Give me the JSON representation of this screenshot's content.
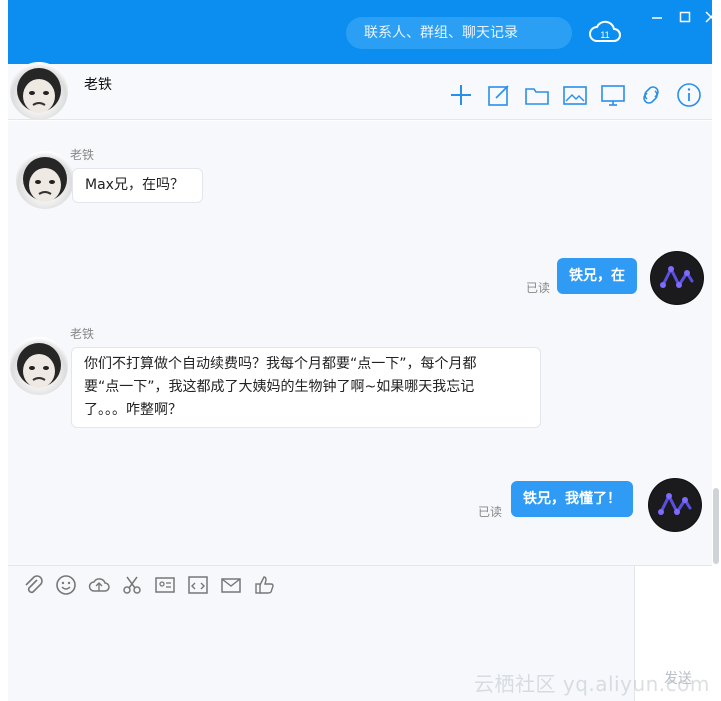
{
  "topbar": {
    "search_placeholder": "联系人、群组、聊天记录",
    "colors": {
      "bar": "#0c8ef0",
      "search": "#2a9ff3"
    }
  },
  "header": {
    "contact_name": "老铁",
    "tools": [
      "add-icon",
      "edit-note-icon",
      "folder-icon",
      "image-icon",
      "screen-share-icon",
      "link-icon",
      "info-icon"
    ]
  },
  "messages": [
    {
      "direction": "in",
      "sender": "老铁",
      "lines": [
        "Max兄，在吗？"
      ]
    },
    {
      "direction": "out",
      "text": "铁兄，在",
      "status": "已读"
    },
    {
      "direction": "in",
      "sender": "老铁",
      "lines": [
        "你们不打算做个自动续费吗？我每个月都要“点一下”，每个月都",
        "要“点一下”，我这都成了大姨妈的生物钟了啊~如果哪天我忘记",
        "了。。。咋整啊？"
      ]
    },
    {
      "direction": "out",
      "text": "铁兄，我懂了！",
      "status": "已读"
    }
  ],
  "composer": {
    "tools": [
      "attachment-icon",
      "emoji-icon",
      "cloud-upload-icon",
      "scissors-icon",
      "contact-card-icon",
      "code-icon",
      "mail-icon",
      "thumbs-up-icon"
    ],
    "send_label": "发送"
  },
  "watermark": "云栖社区 yq.aliyun.com",
  "colors": {
    "accent": "#2f9bf5",
    "chat_bg": "#f6f8fb"
  }
}
